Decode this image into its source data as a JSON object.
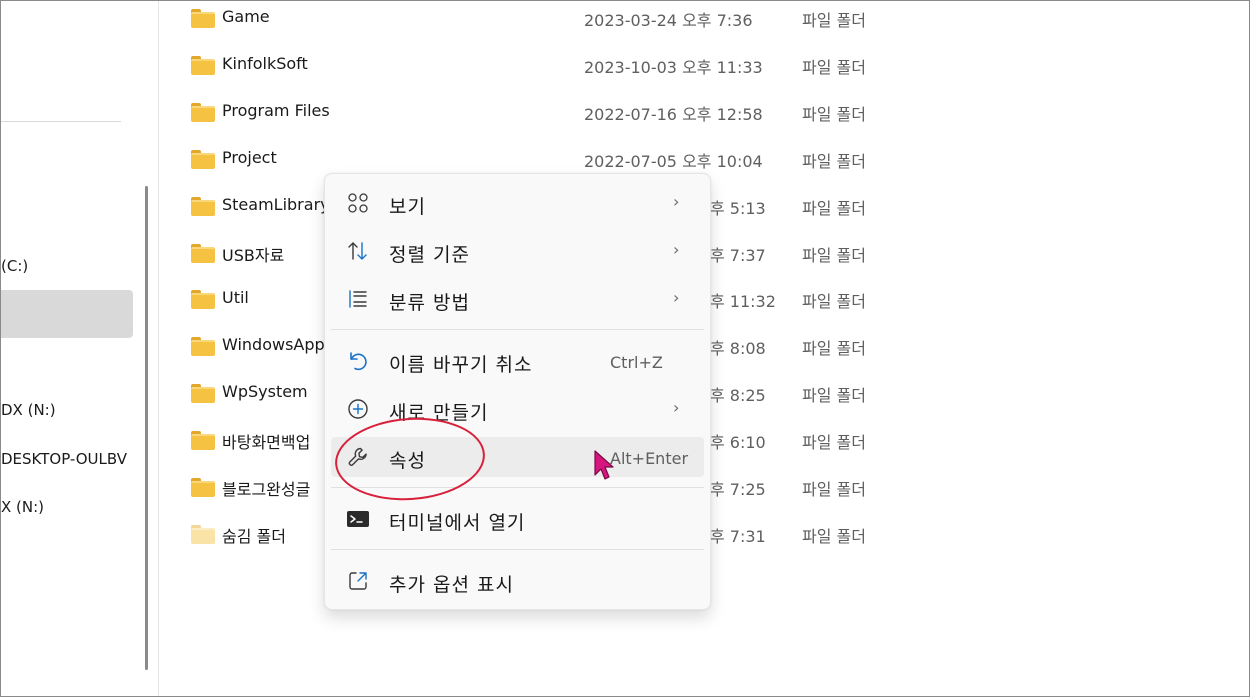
{
  "nav": {
    "items": [
      {
        "label": "(C:)",
        "top": 0
      },
      {
        "label": "DX (N:)"
      },
      {
        "label": "DESKTOP-OULBV"
      },
      {
        "label": "X (N:)"
      }
    ]
  },
  "files": [
    {
      "name": "Game",
      "date": "2023-03-24 오후 7:36",
      "type": "파일 폴더"
    },
    {
      "name": "KinfolkSoft",
      "date": "2023-10-03 오후 11:33",
      "type": "파일 폴더"
    },
    {
      "name": "Program Files",
      "date": "2022-07-16 오후 12:58",
      "type": "파일 폴더"
    },
    {
      "name": "Project",
      "date": "2022-07-05 오후 10:04",
      "type": "파일 폴더"
    },
    {
      "name": "SteamLibrary",
      "date": "후 5:13",
      "type": "파일 폴더"
    },
    {
      "name": "USB자료",
      "date": "후 7:37",
      "type": "파일 폴더"
    },
    {
      "name": "Util",
      "date": "후 11:32",
      "type": "파일 폴더"
    },
    {
      "name": "WindowsApp",
      "date": "후 8:08",
      "type": "파일 폴더"
    },
    {
      "name": "WpSystem",
      "date": "후 8:25",
      "type": "파일 폴더"
    },
    {
      "name": "바탕화면백업",
      "date": "후 6:10",
      "type": "파일 폴더"
    },
    {
      "name": "블로그완성글",
      "date": "후 7:25",
      "type": "파일 폴더"
    },
    {
      "name": "숨김 폴더",
      "date": "후 7:31",
      "type": "파일 폴더",
      "hidden": true
    }
  ],
  "context_menu": {
    "items": [
      {
        "label": "보기",
        "icon": "view-grid-icon",
        "submenu": true
      },
      {
        "label": "정렬 기준",
        "icon": "sort-icon",
        "submenu": true
      },
      {
        "label": "분류 방법",
        "icon": "group-by-icon",
        "submenu": true
      },
      {
        "label": "이름 바꾸기 취소",
        "icon": "undo-icon",
        "shortcut": "Ctrl+Z"
      },
      {
        "label": "새로 만들기",
        "icon": "new-plus-icon",
        "submenu": true
      },
      {
        "label": "속성",
        "icon": "wrench-icon",
        "shortcut": "Alt+Enter",
        "highlighted": true
      },
      {
        "label": "터미널에서 열기",
        "icon": "terminal-icon"
      },
      {
        "label": "추가 옵션 표시",
        "icon": "show-more-options-icon"
      }
    ],
    "chevron": "›"
  },
  "colors": {
    "accent": "#1a73c7",
    "annotation": "#d8203b",
    "cursor": "#d6157f"
  }
}
